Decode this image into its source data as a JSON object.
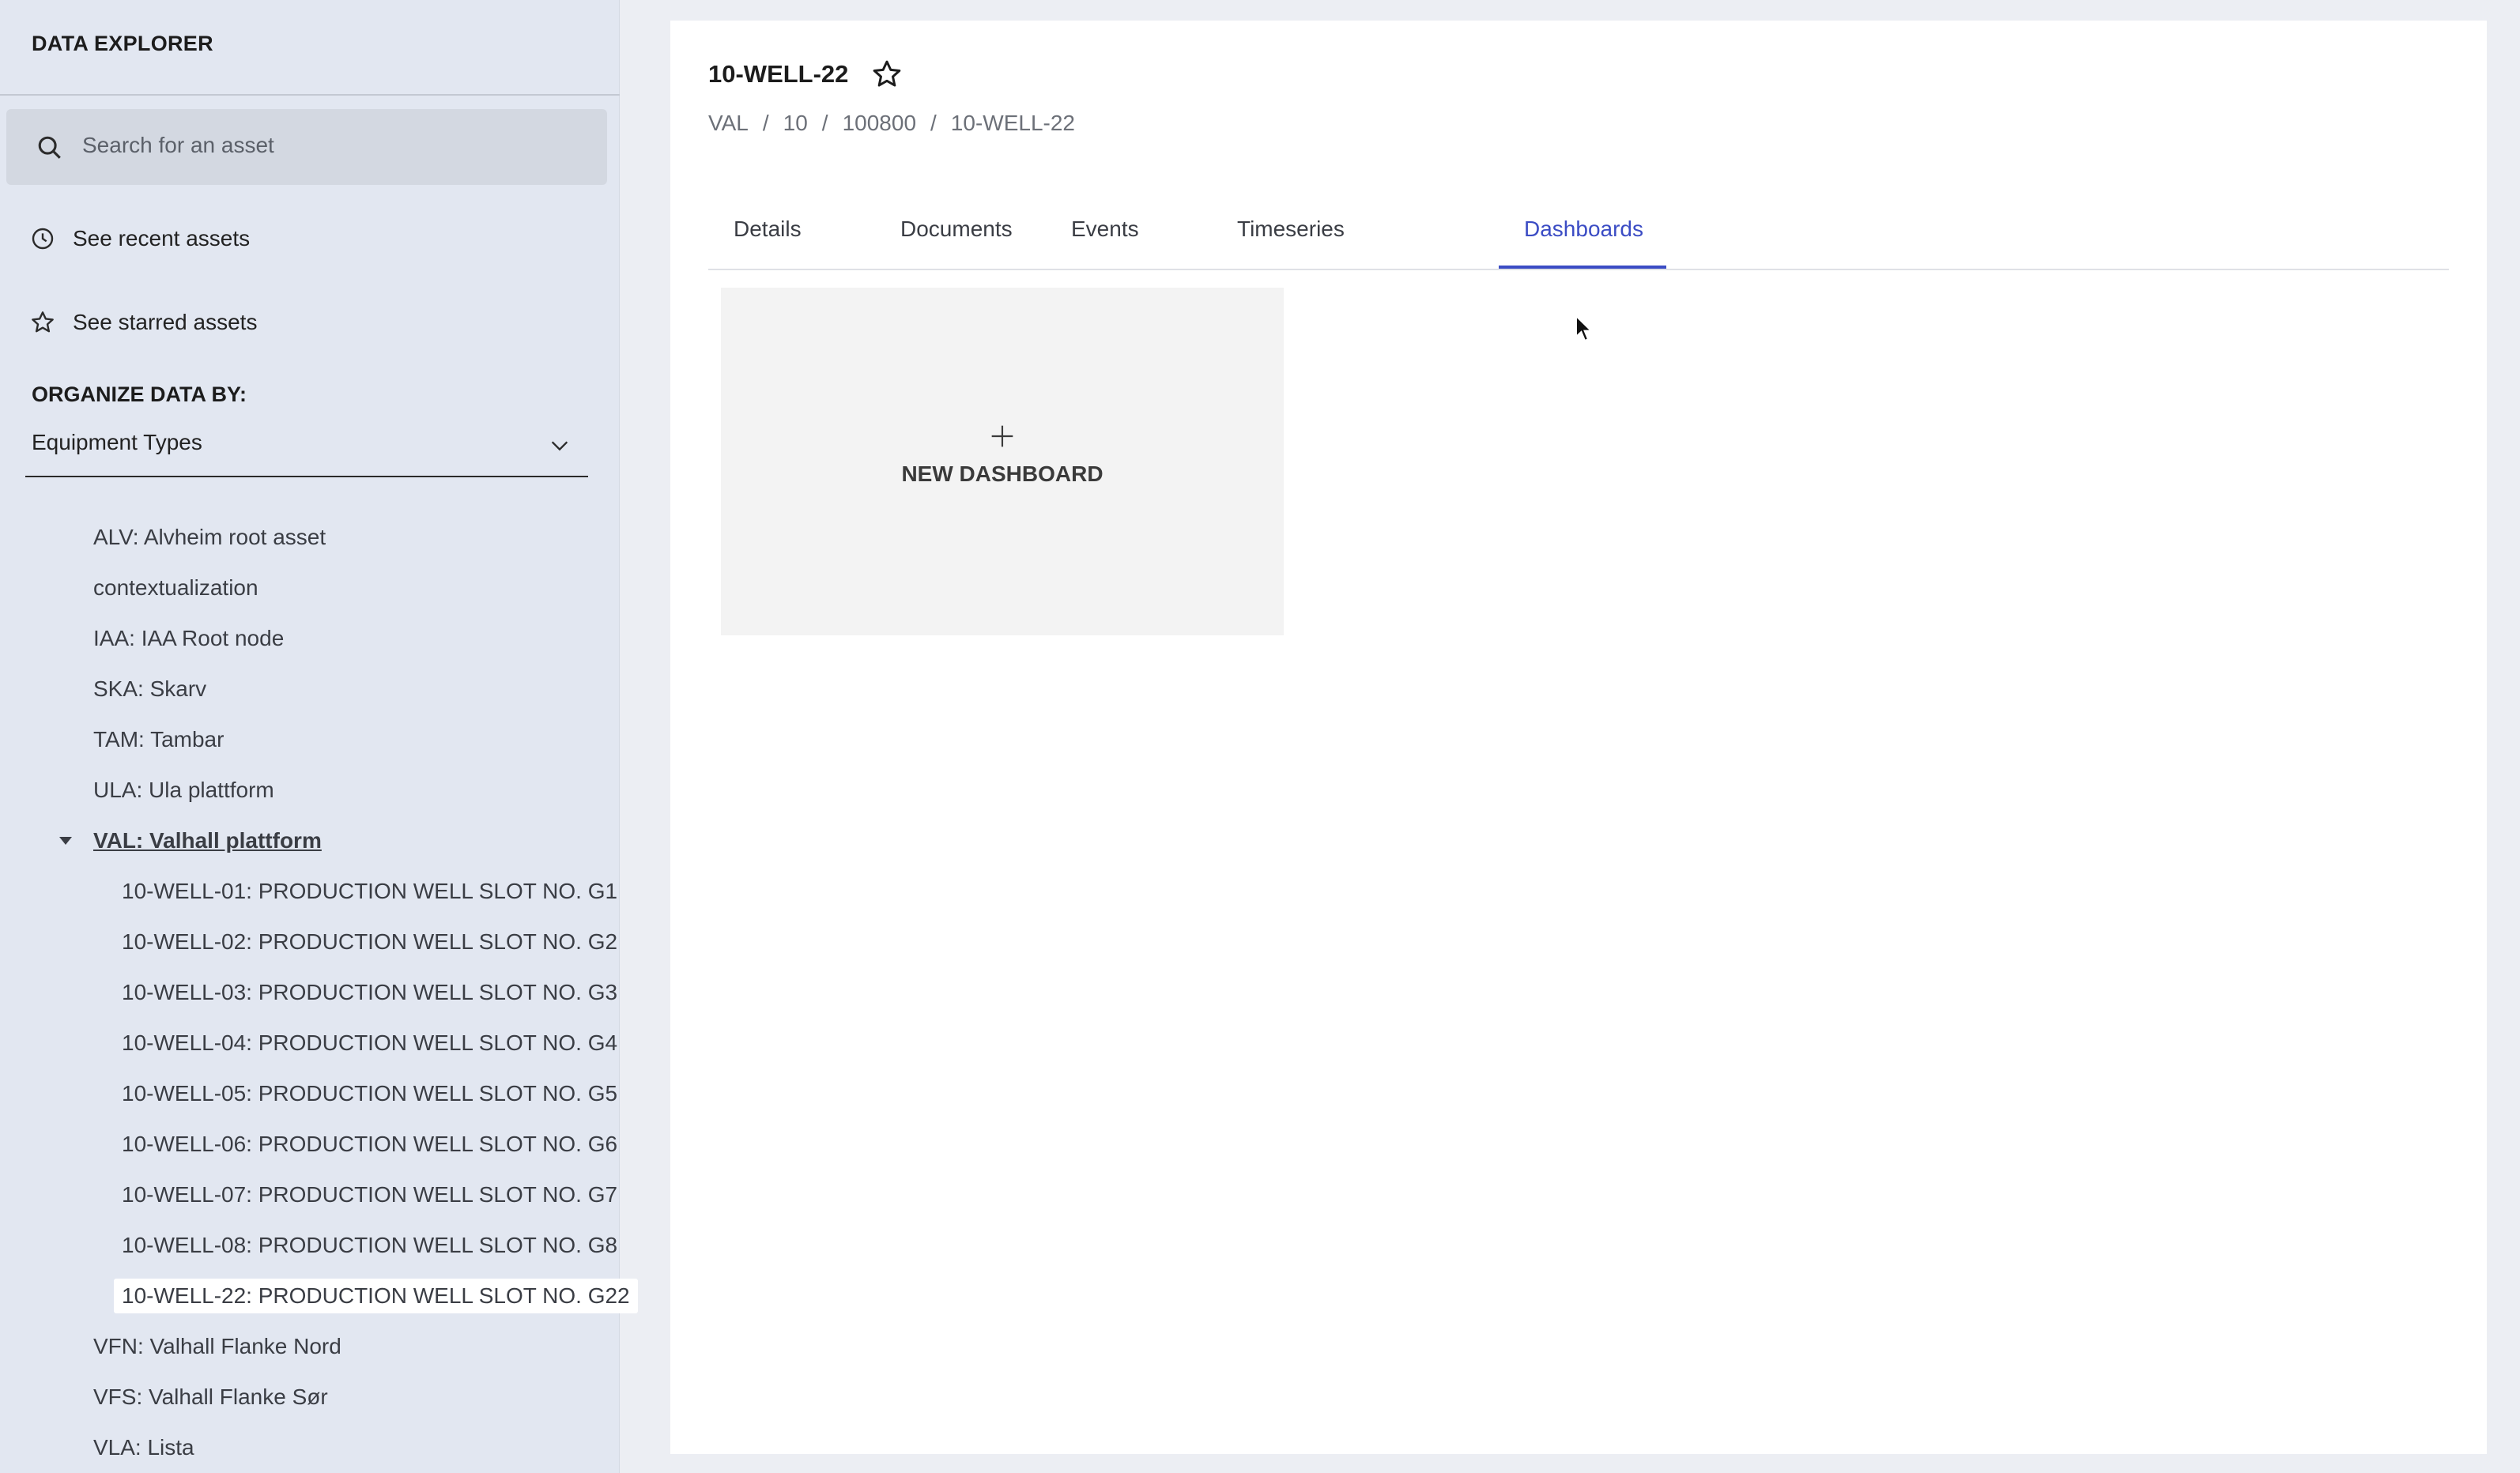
{
  "sidebar": {
    "title": "DATA EXPLORER",
    "search_placeholder": "Search for an asset",
    "recent_label": "See recent assets",
    "starred_label": "See starred assets",
    "organize_label": "ORGANIZE DATA BY:",
    "organize_value": "Equipment Types",
    "tree": [
      {
        "label": "ALV: Alvheim root asset"
      },
      {
        "label": "contextualization"
      },
      {
        "label": "IAA: IAA Root node"
      },
      {
        "label": "SKA: Skarv"
      },
      {
        "label": "TAM: Tambar"
      },
      {
        "label": "ULA: Ula plattform"
      },
      {
        "label": "VAL: Valhall plattform"
      },
      {
        "label": "10-WELL-01: PRODUCTION WELL SLOT NO. G1"
      },
      {
        "label": "10-WELL-02: PRODUCTION WELL SLOT NO. G2"
      },
      {
        "label": "10-WELL-03: PRODUCTION WELL SLOT NO. G3"
      },
      {
        "label": "10-WELL-04: PRODUCTION WELL SLOT NO. G4"
      },
      {
        "label": "10-WELL-05: PRODUCTION WELL SLOT NO. G5"
      },
      {
        "label": "10-WELL-06: PRODUCTION WELL SLOT NO. G6"
      },
      {
        "label": "10-WELL-07: PRODUCTION WELL SLOT NO. G7"
      },
      {
        "label": "10-WELL-08: PRODUCTION WELL SLOT NO. G8"
      },
      {
        "label": "10-WELL-22: PRODUCTION WELL SLOT NO. G22"
      },
      {
        "label": "VFN: Valhall Flanke Nord"
      },
      {
        "label": "VFS: Valhall Flanke Sør"
      },
      {
        "label": "VLA: Lista"
      }
    ]
  },
  "main": {
    "title": "10-WELL-22",
    "breadcrumb": [
      "VAL",
      "10",
      "100800",
      "10-WELL-22"
    ],
    "tabs": [
      "Details",
      "Documents",
      "Events",
      "Timeseries",
      "Dashboards"
    ],
    "active_tab": "Dashboards",
    "new_dashboard_label": "NEW DASHBOARD"
  },
  "colors": {
    "accent": "#3b4cc4",
    "sidebar_bg": "#e2e7f1"
  }
}
